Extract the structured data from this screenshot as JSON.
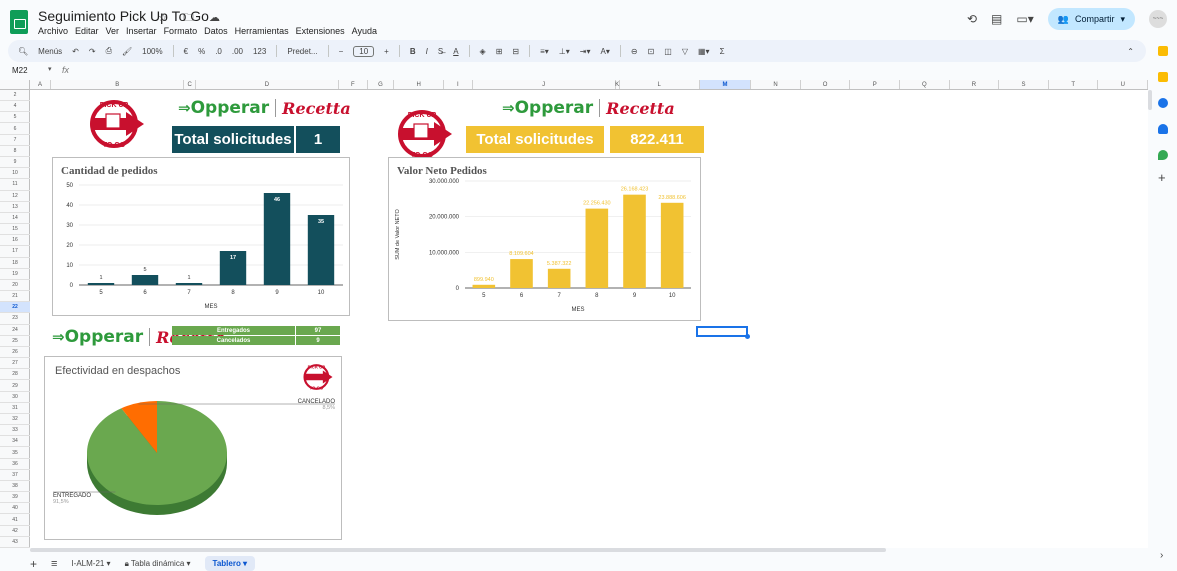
{
  "app": {
    "title": "Seguimiento Pick Up To Go",
    "menus": [
      "Archivo",
      "Editar",
      "Ver",
      "Insertar",
      "Formato",
      "Datos",
      "Herramientas",
      "Extensiones",
      "Ayuda"
    ],
    "share_label": "Compartir",
    "avatar_text": "~~~",
    "title_icons": "☆ 🗀 ☁"
  },
  "toolbar": {
    "search": "Menús",
    "zoom": "100%",
    "currency": "€",
    "percent": "%",
    "dec_less": ".0",
    "dec_more": ".00",
    "num_format": "123",
    "font": "Predet...",
    "font_size": "10",
    "bold": "B",
    "italic": "I",
    "strike": "S̶",
    "text_color": "A",
    "sum": "Σ"
  },
  "formula": {
    "cell_ref": "M22",
    "fx": "fx",
    "value": ""
  },
  "columns": [
    {
      "name": "A",
      "w": 22
    },
    {
      "name": "B",
      "w": 140
    },
    {
      "name": "C",
      "w": 12
    },
    {
      "name": "D",
      "w": 150
    },
    {
      "name": "E",
      "w": 0
    },
    {
      "name": "F",
      "w": 30
    },
    {
      "name": "G",
      "w": 28
    },
    {
      "name": "H",
      "w": 52
    },
    {
      "name": "I",
      "w": 30
    },
    {
      "name": "J",
      "w": 150
    },
    {
      "name": "K",
      "w": 4
    },
    {
      "name": "L",
      "w": 84
    },
    {
      "name": "M",
      "w": 54,
      "selected": true
    },
    {
      "name": "N",
      "w": 52
    },
    {
      "name": "O",
      "w": 52
    },
    {
      "name": "P",
      "w": 52
    },
    {
      "name": "Q",
      "w": 52
    },
    {
      "name": "R",
      "w": 52
    },
    {
      "name": "S",
      "w": 52
    },
    {
      "name": "T",
      "w": 52
    },
    {
      "name": "U",
      "w": 52
    }
  ],
  "rows": [
    "2",
    "4",
    "5",
    "6",
    "7",
    "8",
    "9",
    "10",
    "11",
    "12",
    "13",
    "14",
    "15",
    "16",
    "17",
    "18",
    "19",
    "20",
    "21",
    "22",
    "23",
    "24",
    "25",
    "26",
    "27",
    "28",
    "29",
    "30",
    "31",
    "32",
    "33",
    "34",
    "35",
    "36",
    "37",
    "38",
    "39",
    "40",
    "41",
    "42",
    "43"
  ],
  "selected_row": "22",
  "dashboard_left": {
    "brand_a": "Opperar",
    "brand_b": "Recetta",
    "kpi_label": "Total solicitudes",
    "kpi_value": "1",
    "kpi_color": "#134f5c"
  },
  "dashboard_right": {
    "brand_a": "Opperar",
    "brand_b": "Recetta",
    "kpi_label": "Total solicitudes",
    "kpi_value": "822.411",
    "kpi_color": "#f1c232"
  },
  "pickup_logo": {
    "line1": "PICK UP",
    "line2": "TO GO"
  },
  "status_table": {
    "rows": [
      {
        "label": "Entregados",
        "value": "97"
      },
      {
        "label": "Cancelados",
        "value": "9"
      }
    ],
    "color": "#6aa84f"
  },
  "chart_data": [
    {
      "type": "bar",
      "title": "Cantidad de pedidos",
      "xlabel": "MES",
      "ylabel": "",
      "categories": [
        "5",
        "6",
        "7",
        "8",
        "9",
        "10"
      ],
      "values": [
        1,
        5,
        1,
        17,
        46,
        35
      ],
      "data_labels": [
        "1",
        "5",
        "1",
        "17",
        "46",
        "35"
      ],
      "yticks": [
        "0",
        "10",
        "20",
        "30",
        "40",
        "50"
      ],
      "ylim": [
        0,
        50
      ],
      "color": "#134f5c",
      "grid": true
    },
    {
      "type": "bar",
      "title": "Valor Neto Pedidos",
      "xlabel": "MES",
      "ylabel": "SUM de Valor NETO",
      "categories": [
        "5",
        "6",
        "7",
        "8",
        "9",
        "10"
      ],
      "values": [
        899940,
        8109604,
        5387322,
        22256430,
        26168423,
        23888606
      ],
      "data_labels": [
        "899.940",
        "8.109.604",
        "5.387.322",
        "22.256.430",
        "26.168.423",
        "23.888.606"
      ],
      "yticks": [
        "0",
        "10.000.000",
        "20.000.000",
        "30.000.000"
      ],
      "ylim": [
        0,
        30000000
      ],
      "color": "#f1c232",
      "grid": true
    },
    {
      "type": "pie",
      "title": "Efectividad en despachos",
      "slices": [
        {
          "label": "ENTREGADO",
          "pct_label": "91,5%",
          "value": 91.5,
          "color": "#6aa84f"
        },
        {
          "label": "CANCELADO",
          "pct_label": "8,5%",
          "value": 8.5,
          "color": "#ff6d01"
        }
      ],
      "style": "3d"
    }
  ],
  "tabs": {
    "add": "+",
    "all": "≡",
    "items": [
      {
        "label": "I-ALM-21 ▾",
        "active": false
      },
      {
        "label": "Tabla dinámica ▾",
        "active": false
      },
      {
        "label": "Tablero ▾",
        "active": true
      }
    ]
  }
}
